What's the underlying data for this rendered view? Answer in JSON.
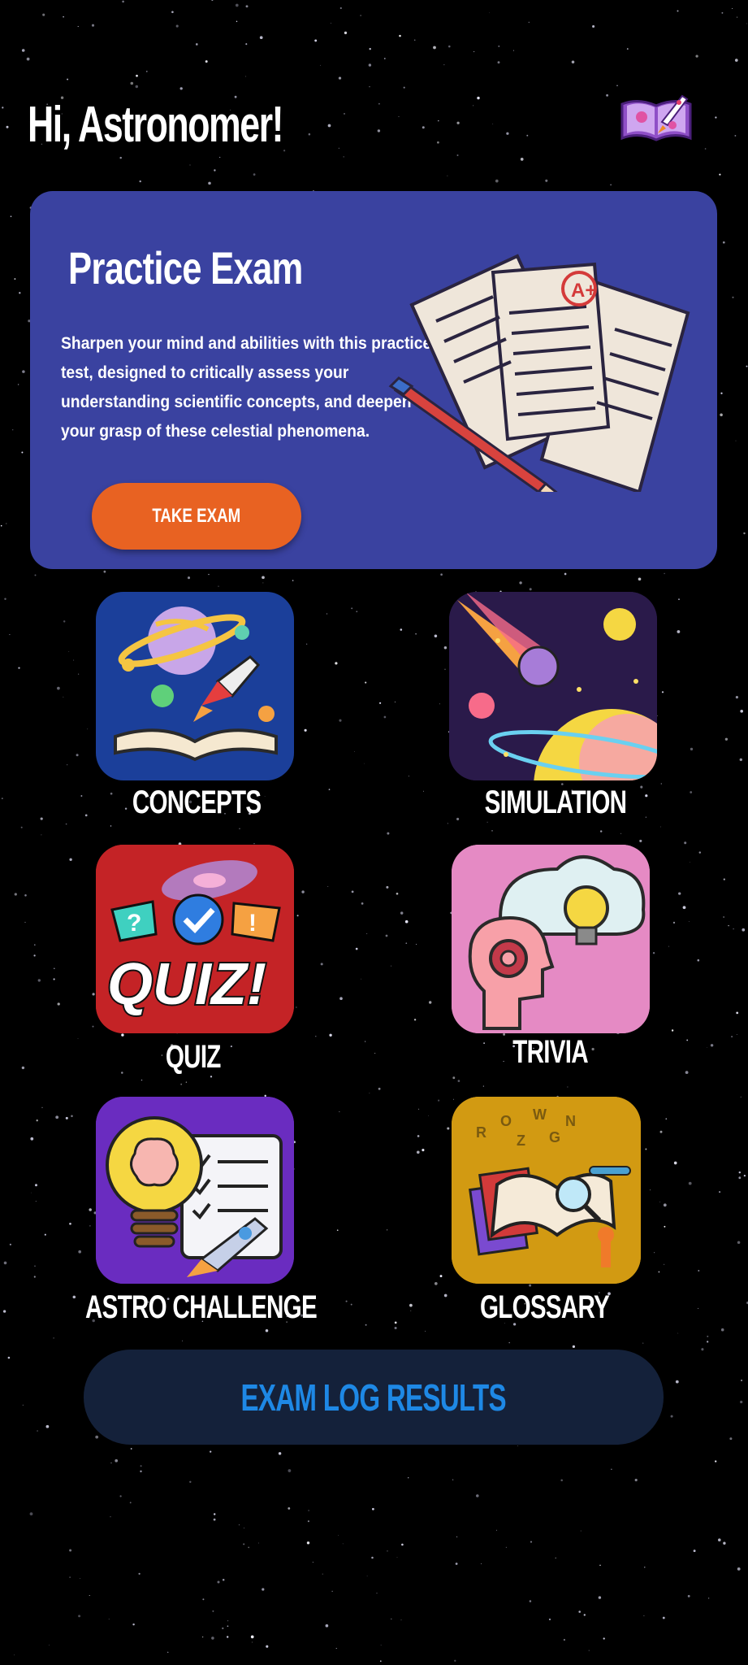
{
  "header": {
    "greeting": "Hi, Astronomer!",
    "logo_icon": "space-book-icon"
  },
  "exam_card": {
    "title": "Practice Exam",
    "description": "Sharpen your mind and abilities with this practice test, designed to critically assess your understanding scientific concepts, and deepen your grasp of these celestial phenomena.",
    "button_label": "TAKE EXAM",
    "illustration_icon": "exam-papers-icon",
    "colors": {
      "card": "#3a42a0",
      "button": "#e86222"
    }
  },
  "tiles": [
    {
      "label": "CONCEPTS",
      "icon": "planet-book-rocket-icon",
      "bg": "#1b3f9a"
    },
    {
      "label": "SIMULATION",
      "icon": "comet-planets-icon",
      "bg": "#2a1a4a"
    },
    {
      "label": "QUIZ",
      "icon": "quiz-galaxy-icon",
      "bg": "#c42326"
    },
    {
      "label": "TRIVIA",
      "icon": "head-gear-lightbulb-icon",
      "bg": "#e58ac4"
    },
    {
      "label": "ASTRO CHALLENGE",
      "icon": "brain-bulb-checklist-icon",
      "bg": "#6a2cc0"
    },
    {
      "label": "GLOSSARY",
      "icon": "open-book-magnifier-icon",
      "bg": "#d29a12"
    }
  ],
  "results_button": {
    "label": "EXAM LOG RESULTS",
    "bg": "#14213a",
    "color": "#1e88e5"
  }
}
